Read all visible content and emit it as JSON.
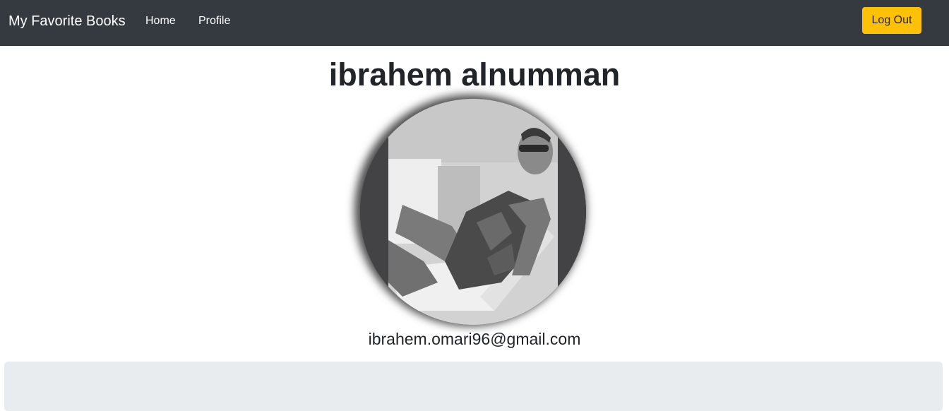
{
  "navbar": {
    "brand": "My Favorite Books",
    "links": [
      {
        "label": "Home"
      },
      {
        "label": "Profile"
      }
    ],
    "logout_label": "Log Out",
    "background_color": "#343a40",
    "logout_color": "#ffc107"
  },
  "profile": {
    "name": "ibrahem alnumman",
    "email": "ibrahem.omari96@gmail.com",
    "avatar_icon": "profile-photo"
  },
  "panel": {
    "background_color": "#e9ecef"
  }
}
